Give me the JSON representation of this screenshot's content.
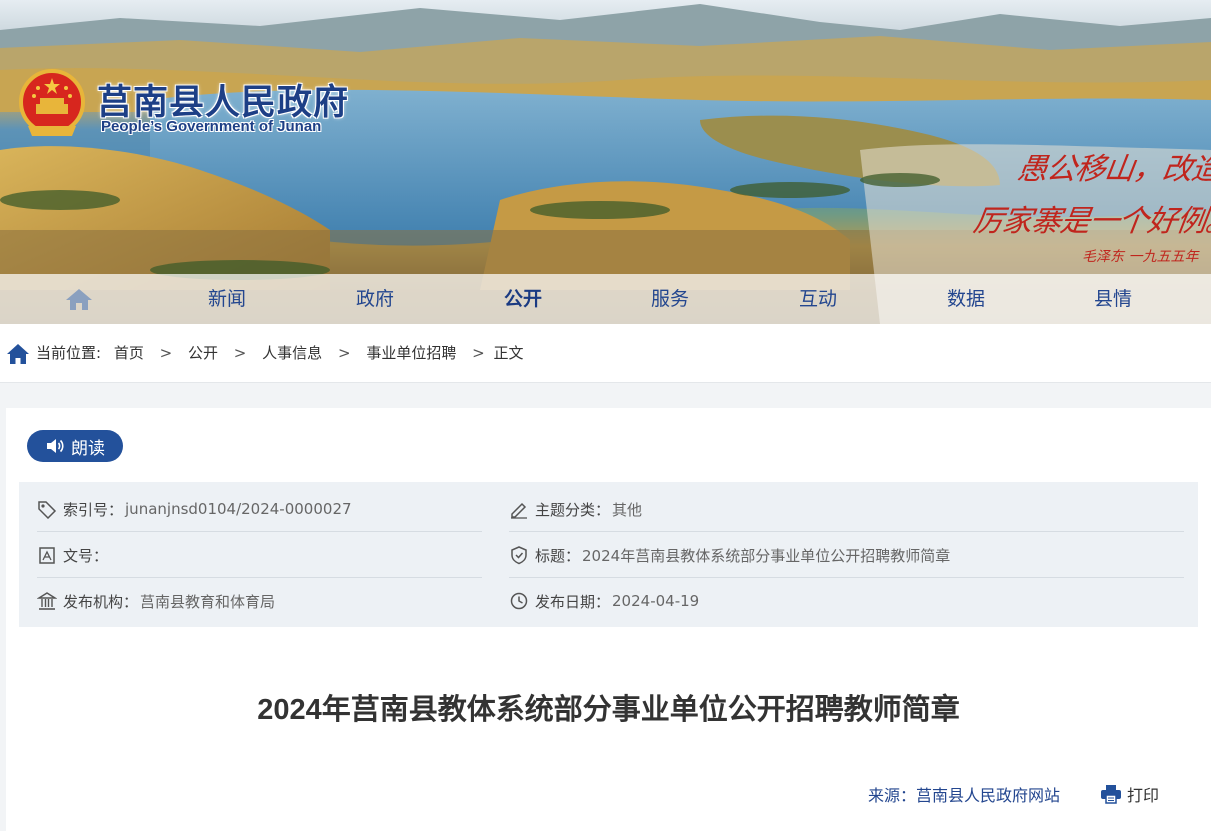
{
  "header": {
    "site_title": "莒南县人民政府",
    "site_subtitle": "People’s Government of Junan",
    "calligraphy": {
      "line1": "愚公移山，改造中国，",
      "line2": "厉家寨是一个好例。",
      "signature": "毛泽东 一九五五年"
    }
  },
  "nav": {
    "home_icon": "home-icon",
    "items": [
      {
        "label": "新闻",
        "active": false
      },
      {
        "label": "政府",
        "active": false
      },
      {
        "label": "公开",
        "active": true
      },
      {
        "label": "服务",
        "active": false
      },
      {
        "label": "互动",
        "active": false
      },
      {
        "label": "数据",
        "active": false
      },
      {
        "label": "县情",
        "active": false
      }
    ]
  },
  "breadcrumb": {
    "prefix": "当前位置:",
    "items": [
      "首页",
      "公开",
      "人事信息",
      "事业单位招聘",
      "正文"
    ],
    "separator": ">"
  },
  "read_button": {
    "label": "朗读",
    "icon": "speaker-icon"
  },
  "meta": {
    "index_label": "索引号：",
    "index_value": "junanjnsd0104/2024-0000027",
    "category_label": "主题分类：",
    "category_value": "其他",
    "doc_no_label": "文号：",
    "doc_no_value": "",
    "title_label": "标题：",
    "title_value": "2024年莒南县教体系统部分事业单位公开招聘教师简章",
    "publisher_label": "发布机构：",
    "publisher_value": "莒南县教育和体育局",
    "date_label": "发布日期：",
    "date_value": "2024-04-19"
  },
  "article": {
    "title": "2024年莒南县教体系统部分事业单位公开招聘教师简章",
    "source_label": "来源：",
    "source_value": "莒南县人民政府网站",
    "print_label": "打印"
  },
  "colors": {
    "brand_blue": "#23519b",
    "nav_text": "#23468f",
    "meta_bg": "#edf1f5",
    "calligraphy_red": "#c0251d"
  }
}
